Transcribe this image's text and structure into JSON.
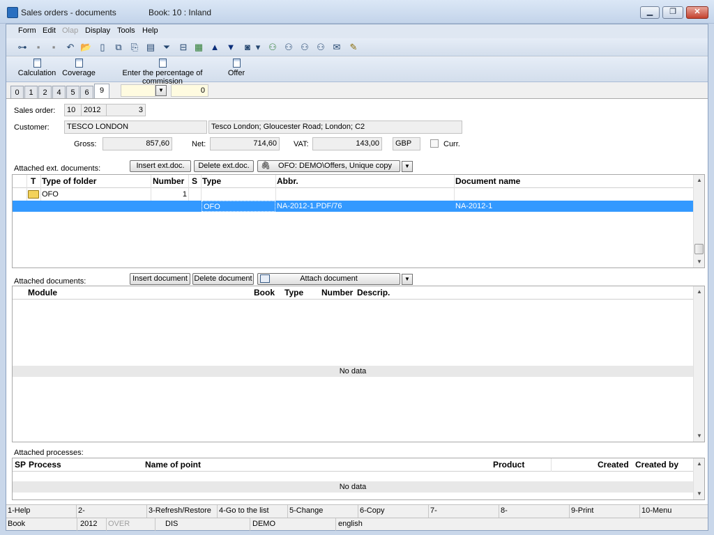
{
  "window": {
    "title": "Sales orders - documents",
    "book": "Book: 10 : Inland",
    "minimize_glyph": "▁",
    "maximize_glyph": "❐",
    "close_glyph": "✕"
  },
  "menu": {
    "items": [
      {
        "label": "Form",
        "disabled": false
      },
      {
        "label": "Edit",
        "disabled": false
      },
      {
        "label": "Olap",
        "disabled": true
      },
      {
        "label": "Display",
        "disabled": false
      },
      {
        "label": "Tools",
        "disabled": false
      },
      {
        "label": "Help",
        "disabled": false
      }
    ]
  },
  "toolbar": {
    "icons": [
      "tree-icon",
      "save-icon",
      "save-as-icon",
      "undo-icon",
      "open-folder-icon",
      "new-document-icon",
      "copy-icon",
      "paste-icon",
      "book-icon",
      "filter-icon",
      "filter-list-icon",
      "stack-icon",
      "arrow-up-icon",
      "arrow-down-icon",
      "camera-icon",
      "dropdown-arrow-icon",
      "binoculars-check-icon",
      "binoculars-icon",
      "binoculars-next-icon",
      "binoculars-prev-icon",
      "mail-icon",
      "notes-icon"
    ],
    "glyphs": [
      "⊶",
      "▪",
      "▪",
      "↶",
      "📂",
      "▯",
      "⧉",
      "⎘",
      "▤",
      "⏷",
      "⊟",
      "▦",
      "▲",
      "▼",
      "◙",
      "▾",
      "⚇",
      "⚇",
      "⚇",
      "⚇",
      "✉",
      "✎"
    ]
  },
  "actions": [
    {
      "label": "Calculation"
    },
    {
      "label": "Coverage"
    },
    {
      "label": "Enter the percentage of commission"
    },
    {
      "label": "Offer"
    }
  ],
  "tabs": [
    "0",
    "1",
    "2",
    "4",
    "5",
    "6",
    "9"
  ],
  "active_tab": "9",
  "tab_filter": {
    "value": "",
    "number": "0"
  },
  "form": {
    "sales_order_label": "Sales order:",
    "order_book": "10",
    "order_year": "2012",
    "order_number": "3",
    "customer_label": "Customer:",
    "customer_name": "TESCO LONDON",
    "customer_address": "Tesco London; Gloucester Road; London; C2",
    "gross_label": "Gross:",
    "gross_value": "857,60",
    "net_label": "Net:",
    "net_value": "714,60",
    "vat_label": "VAT:",
    "vat_value": "143,00",
    "currency": "GBP",
    "curr_label": "Curr."
  },
  "ext_docs": {
    "label": "Attached ext. documents:",
    "insert_button": "Insert ext.doc.",
    "delete_button": "Delete ext.doc.",
    "folder_combo": "OFO: DEMO\\Offers, Unique copy",
    "columns": [
      "T",
      "Type of folder",
      "Number",
      "S",
      "Type",
      "Abbr.",
      "Document name"
    ],
    "rows": [
      {
        "t": "",
        "type_of_folder": "OFO",
        "number": "1",
        "s": "",
        "type": "",
        "abbr": "",
        "document_name": "",
        "selected": false
      },
      {
        "t": "",
        "type_of_folder": "",
        "number": "",
        "s": "",
        "type": "OFO",
        "abbr": "NA-2012-1.PDF/76",
        "document_name": "NA-2012-1",
        "selected": true
      }
    ]
  },
  "attached_docs": {
    "label": "Attached documents:",
    "insert_button": "Insert document",
    "delete_button": "Delete document",
    "attach_button": "Attach document",
    "columns": [
      "Module",
      "Book",
      "Type",
      "Number",
      "Descrip."
    ],
    "empty_text": "No data"
  },
  "processes": {
    "label": "Attached processes:",
    "columns": [
      "SP",
      "Process",
      "Name of point",
      "Product",
      "Created",
      "Created by"
    ],
    "empty_text": "No data"
  },
  "fkeys": [
    "1-Help",
    "2-",
    "3-Refresh/Restore",
    "4-Go to the list",
    "5-Change",
    "6-Copy",
    "7-",
    "8-",
    "9-Print",
    "10-Menu"
  ],
  "status": {
    "book": "Book",
    "year": "2012",
    "over": "OVER",
    "dis": "DIS",
    "demo": "DEMO",
    "language": "english"
  }
}
